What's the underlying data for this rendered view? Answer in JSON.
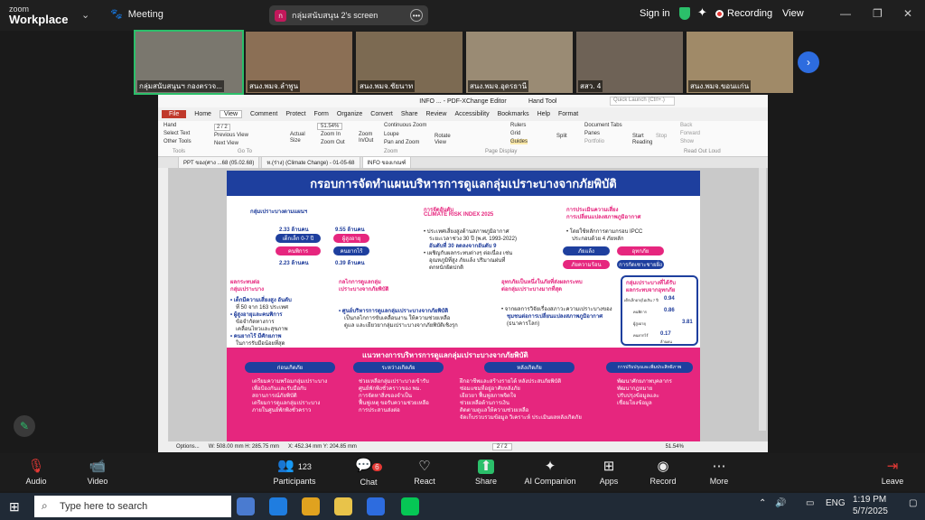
{
  "app": {
    "logo_top": "zoom",
    "logo_bottom": "Workplace",
    "meeting_label": "Meeting"
  },
  "share_banner": {
    "badge": "ก",
    "text": "กลุ่มสนับสนุน 2's screen"
  },
  "header_right": {
    "signin": "Sign in",
    "recording": "Recording",
    "view": "View"
  },
  "participants": [
    {
      "name": "กลุ่มสนับสนุนฯ กองตรวจ..."
    },
    {
      "name": "สนง.พมจ.ลำพูน"
    },
    {
      "name": "สนง.พมจ.ชัยนาท"
    },
    {
      "name": "สนง.พมจ.อุดรธานี"
    },
    {
      "name": "สสว. 4"
    },
    {
      "name": "สนง.พมจ.ขอนแก่น"
    }
  ],
  "pdf": {
    "window_title": "INFO ... - PDF-XChange Editor",
    "tool_label": "Hand Tool",
    "search_placeholder": "Quick Launch (Ctrl+.)",
    "menu": [
      "File",
      "Home",
      "Comment",
      "Protect",
      "Form",
      "Organize",
      "Convert",
      "Share",
      "Review",
      "Accessibility",
      "Bookmarks",
      "Help",
      "Format"
    ],
    "menu_active": "View",
    "ribbon": {
      "hand": "Hand",
      "select_text": "Select Text",
      "other_tools": "Other Tools",
      "prev_view": "Previous View",
      "next_view": "Next View",
      "page_field": "2 / 2",
      "zoom": "51.54%",
      "actual_size": "Actual Size",
      "zoom_in": "Zoom In",
      "zoom_out": "Zoom Out",
      "zoom_inout": "Zoom In/Out",
      "continuous_zoom": "Continuous Zoom",
      "loupe": "Loupe",
      "pan_zoom": "Pan and Zoom",
      "rotate": "Rotate View",
      "rulers": "Rulers",
      "grid": "Grid",
      "guides": "Guides",
      "split": "Split",
      "doc_tabs": "Document Tabs",
      "panes": "Panes",
      "portfolio": "Portfolio",
      "start_reading": "Start Reading",
      "stop": "Stop",
      "back": "Back",
      "forward": "Forward",
      "show": "Show",
      "group_tools": "Tools",
      "group_goto": "Go To",
      "group_zoom": "Zoom",
      "group_pagedisplay": "Page Display",
      "group_readout": "Read Out Loud"
    },
    "tabs": [
      "PPT ของ(ศาง ...68 (05.02.68)",
      "ห.(ร่าง) (Climate Change) - 01-05-68",
      "INFO ของเกณฑ์"
    ],
    "status": {
      "options": "Options...",
      "dims": "W: 508.00 mm  H: 285.75 mm",
      "coords": "X: 452.34 mm  Y: 204.85 mm",
      "page": "2 / 2",
      "zoom": "51.54%"
    },
    "doc": {
      "title": "กรอบการจัดทำแผนบริหารการดูแลกลุ่มเปราะบางจากภัยพิบัติ",
      "s1_head": "กลุ่มเปราะบางตามแผนฯ",
      "s1_a": "2.33 ล้านคน",
      "s1_b": "9.55 ล้านคน",
      "s1_c": "เด็กเล็ก 0-7 ปี",
      "s1_d": "ผู้สูงอายุ",
      "s1_e": "คนพิการ",
      "s1_f": "คนยากไร้",
      "s1_g": "2.23 ล้านคน",
      "s1_h": "0.39 ล้านคน",
      "s2_head": "การจัดอันดับ",
      "s2_head2": "CLIMATE RISK INDEX 2025",
      "s2_l1": "• ประเทศเสี่ยงสูงด้านสภาพภูมิอากาศ",
      "s2_l2": "ระยะเวลาช่วง 30 ปี (พ.ศ. 1993-2022)",
      "s2_l3": "อันดับที่ 30 ลดลงจากอันดับ 9",
      "s2_l4": "• เผชิญกับผลกระทบต่างๆ ต่อเนื่อง เช่น",
      "s2_l5": "อุณหภูมิที่สูง ภัยแล้ง ปริมาณฝนที่",
      "s2_l6": "ตกหนักผิดปกติ",
      "s3_head": "การประเมินความเสี่ยง",
      "s3_head2": "การเปลี่ยนแปลงสภาพภูมิอากาศ",
      "s3_l1": "• โดยใช้หลักการตามกรอบ IPCC",
      "s3_l2": "ประกอบด้วย 4 ภัยหลัก",
      "s3_p1": "ภัยแล้ง",
      "s3_p2": "อุทกภัย",
      "s3_p3": "ภัยความร้อน",
      "s3_p4": "การกัดเซาะชายฝั่ง",
      "s4_head": "ผลกระทบต่อ",
      "s4_head2": "กลุ่มเปราะบาง",
      "s4_l1": "• เด็กมีความเสี่ยงสูง อันดับ",
      "s4_l2": "ที่ 50 จาก 163 ประเทศ",
      "s4_l3": "• ผู้สูงอายุและคนพิการ",
      "s4_l4": "ข้อจำกัดทางการ",
      "s4_l5": "เคลื่อนไหวและสุขภาพ",
      "s4_l6": "• คนยากไร้ มีศักยภาพ",
      "s4_l7": "ในการรับมือน้อยที่สุด",
      "s5_head": "กลไกการดูแลกลุ่ม",
      "s5_head2": "เปราะบางจากภัยพิบัติ",
      "s5_l1": "• ศูนย์บริหารการดูแลกลุ่มเปราะบางจากภัยพิบัติ",
      "s5_l2": "เป็นกลไกการขับเคลื่อนงาน ให้ความช่วยเหลือ",
      "s5_l3": "ดูแล และเยียวยากลุ่มเปราะบางจากภัยพิบัติเชิงรุก",
      "s6_head": "อุทกภัยเป็นหนึ่งในภัยที่ส่งผลกระทบ",
      "s6_head2": "ต่อกลุ่มเปราะบางมากที่สุด",
      "s6_l1": "• จากผลการวิจัยเรื่องสภาวะความเปราะบางของ",
      "s6_l2": "ชุมชนต่อการเปลี่ยนแปลงสภาพภูมิอากาศ",
      "s6_l3": "(ธนาคารโลก)",
      "s7_head": "กลุ่มเปราะบางที่ได้รับ",
      "s7_head2": "ผลกระทบจากอุทกภัย",
      "s7_r1": "เด็กเล็กอายุไม่เกิน 7 ปี",
      "s7_r2": "คนพิการ",
      "s7_r3": "ผู้สูงอายุ",
      "s7_r4": "คนยากไร้",
      "s7_v1": "0.94",
      "s7_v2": "0.86",
      "s7_v3": "3.81",
      "s7_v4": "0.17",
      "s7_unit": "ล้านคน",
      "pink_title": "แนวทางการบริหารการดูแลกลุ่มเปราะบางจากภัยพิบัติ",
      "ph1": "ก่อนเกิดภัย",
      "ph2": "ระหว่างเกิดภัย",
      "ph3": "หลังเกิดภัย",
      "ph4": "การปรับปรุงและเพิ่มประสิทธิภาพ",
      "c1": [
        "เตรียมความพร้อมกลุ่มเปราะบาง",
        "เพื่อป้องกันและรับมือกับ",
        "สถานการณ์ภัยพิบัติ",
        "เตรียมการดูแลกลุ่มเปราะบาง",
        "ภายในศูนย์พักพิงชั่วคราว"
      ],
      "c2": [
        "ช่วยเหลือกลุ่มเปราะบางเข้ารับ",
        "ศูนย์พักพิงชั่วคราวของ พม.",
        "การจัดหาสิ่งของจำเป็น",
        "ฟื้นฟูเหตุ ขอรับความช่วยเหลือ",
        "การประสานส่งต่อ"
      ],
      "c3": [
        "ฝึกอาชีพและสร้างรายได้ หลังประสบภัยพิบัติ",
        "ซ่อมแซมที่อยู่อาศัยหลังภัย",
        "เยียวยา ฟื้นฟูสภาพจิตใจ",
        "ช่วยเหลือด้านการเงิน",
        "ติดตามดูแลให้ความช่วยเหลือ",
        "จัดเก็บรวบรวมข้อมูล วิเคราะห์ ประเมินผลหลังเกิดภัย"
      ],
      "c4": [
        "พัฒนาศักยภาพบุคลากร",
        "พัฒนากฎหมาย",
        "ปรับปรุงข้อมูลและ",
        "เชื่อมโยงข้อมูล"
      ]
    }
  },
  "controls": [
    {
      "label": "Audio",
      "icon": "🎙"
    },
    {
      "label": "Video",
      "icon": "📹"
    },
    {
      "label": "Participants",
      "icon": "👥",
      "count": "123"
    },
    {
      "label": "Chat",
      "icon": "💬",
      "count": "6"
    },
    {
      "label": "React",
      "icon": "♡"
    },
    {
      "label": "Share",
      "icon": "⬆"
    },
    {
      "label": "AI Companion",
      "icon": "✦"
    },
    {
      "label": "Apps",
      "icon": "⊞"
    },
    {
      "label": "Record",
      "icon": "◉"
    },
    {
      "label": "More",
      "icon": "⋯"
    }
  ],
  "leave": "Leave",
  "taskbar": {
    "search_placeholder": "Type here to search",
    "lang": "ENG",
    "time": "1:19 PM",
    "date": "5/7/2025"
  }
}
